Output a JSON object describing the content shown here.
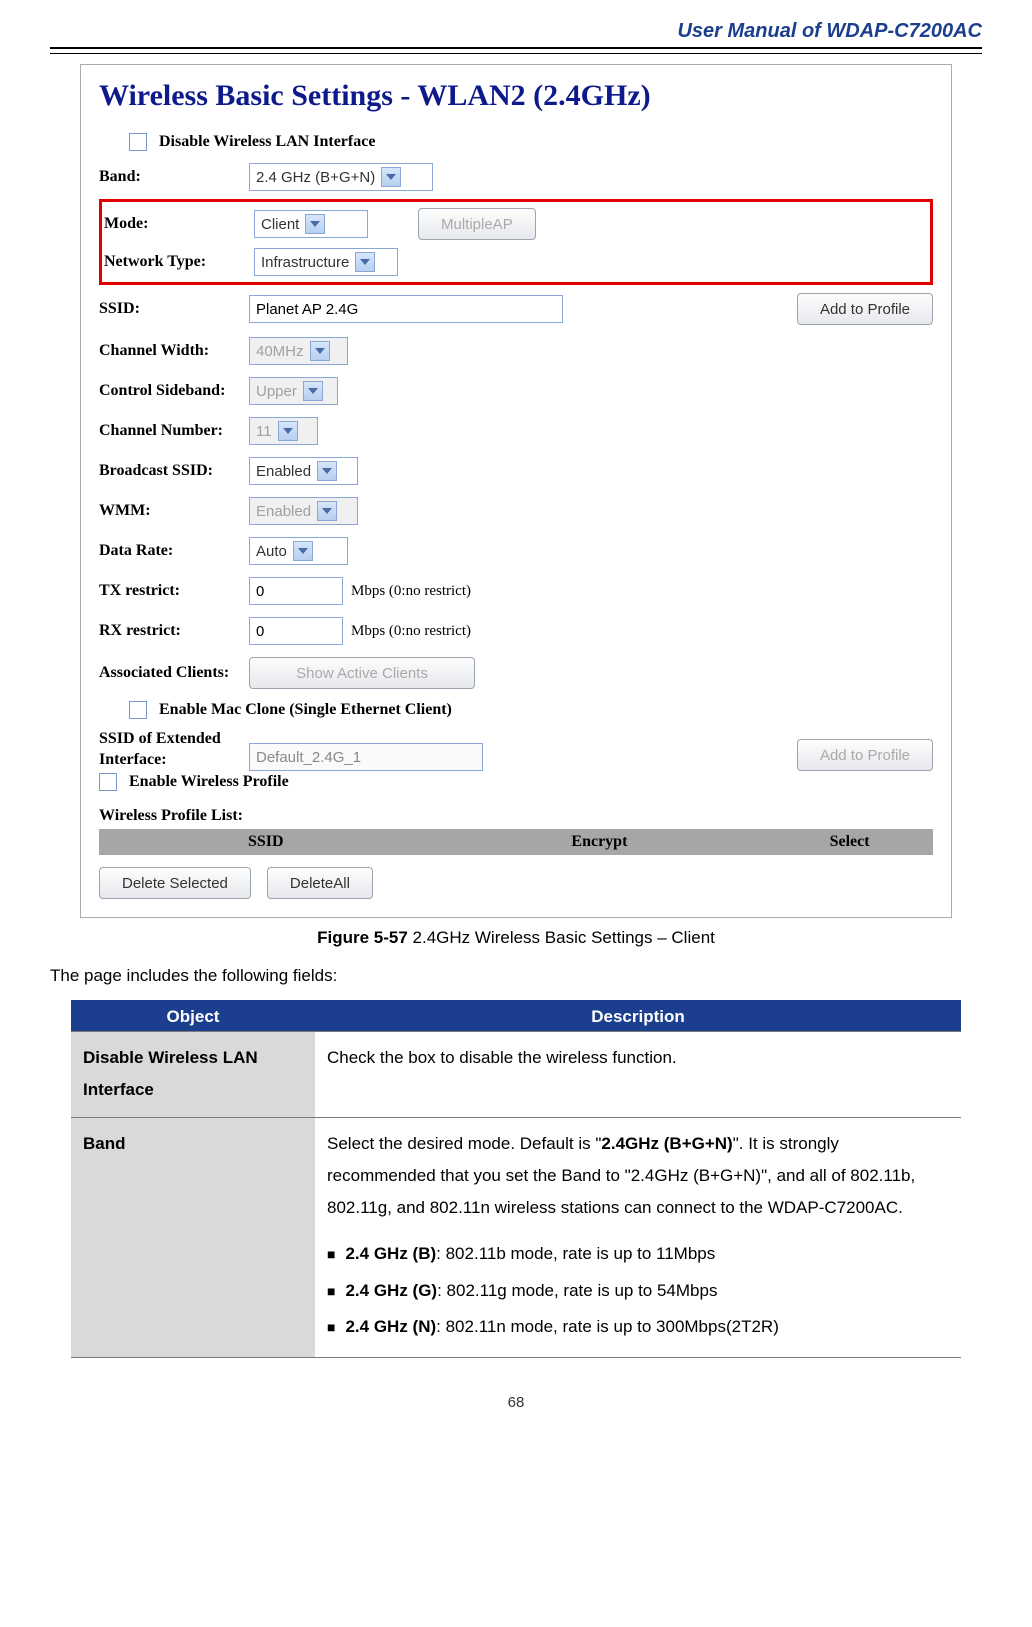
{
  "header": {
    "title": "User Manual of WDAP-C7200AC"
  },
  "screenshot": {
    "title": "Wireless Basic Settings - WLAN2 (2.4GHz)",
    "disable_label": "Disable Wireless LAN Interface",
    "fields": {
      "band": {
        "label": "Band:",
        "value": "2.4 GHz (B+G+N)"
      },
      "mode": {
        "label": "Mode:",
        "value": "Client"
      },
      "multiple_ap_btn": "MultipleAP",
      "network_type": {
        "label": "Network Type:",
        "value": "Infrastructure"
      },
      "ssid": {
        "label": "SSID:",
        "value": "Planet AP 2.4G"
      },
      "add_profile_btn": "Add to Profile",
      "channel_width": {
        "label": "Channel Width:",
        "value": "40MHz"
      },
      "control_sideband": {
        "label": "Control Sideband:",
        "value": "Upper"
      },
      "channel_number": {
        "label": "Channel Number:",
        "value": "11"
      },
      "broadcast_ssid": {
        "label": "Broadcast SSID:",
        "value": "Enabled"
      },
      "wmm": {
        "label": "WMM:",
        "value": "Enabled"
      },
      "data_rate": {
        "label": "Data Rate:",
        "value": "Auto"
      },
      "tx_restrict": {
        "label": "TX restrict:",
        "value": "0",
        "note": "Mbps (0:no restrict)"
      },
      "rx_restrict": {
        "label": "RX restrict:",
        "value": "0",
        "note": "Mbps (0:no restrict)"
      },
      "assoc_clients": {
        "label": "Associated Clients:",
        "button": "Show Active Clients"
      },
      "mac_clone_label": "Enable Mac Clone (Single Ethernet Client)",
      "ssid_ext": {
        "label": "SSID of Extended Interface:",
        "value": "Default_2.4G_1",
        "add_btn": "Add to Profile"
      },
      "enable_profile_label": "Enable Wireless Profile",
      "profile_list_label": "Wireless Profile List:",
      "profile_headers": {
        "ssid": "SSID",
        "encrypt": "Encrypt",
        "select": "Select"
      },
      "delete_selected_btn": "Delete Selected",
      "delete_all_btn": "DeleteAll"
    }
  },
  "figure_caption": {
    "bold": "Figure 5-57",
    "rest": " 2.4GHz Wireless Basic Settings – Client"
  },
  "intro_text": "The page includes the following fields:",
  "table": {
    "headers": {
      "object": "Object",
      "description": "Description"
    },
    "rows": [
      {
        "object": "Disable Wireless LAN Interface",
        "desc": "Check the box to disable the wireless function."
      },
      {
        "object": "Band",
        "desc_pre": "Select the desired mode. Default is \"",
        "desc_bold": "2.4GHz (B+G+N)",
        "desc_post": "\". It is strongly recommended that you set the Band to \"2.4GHz (B+G+N)\", and all of 802.11b, 802.11g, and 802.11n wireless stations can connect to the WDAP-C7200AC.",
        "items": [
          {
            "b": "2.4 GHz (B)",
            "t": ": 802.11b mode, rate is up to 11Mbps"
          },
          {
            "b": "2.4 GHz (G)",
            "t": ": 802.11g mode, rate is up to 54Mbps"
          },
          {
            "b": "2.4 GHz (N)",
            "t": ": 802.11n mode, rate is up to 300Mbps(2T2R)"
          }
        ]
      }
    ]
  },
  "page_number": "68"
}
